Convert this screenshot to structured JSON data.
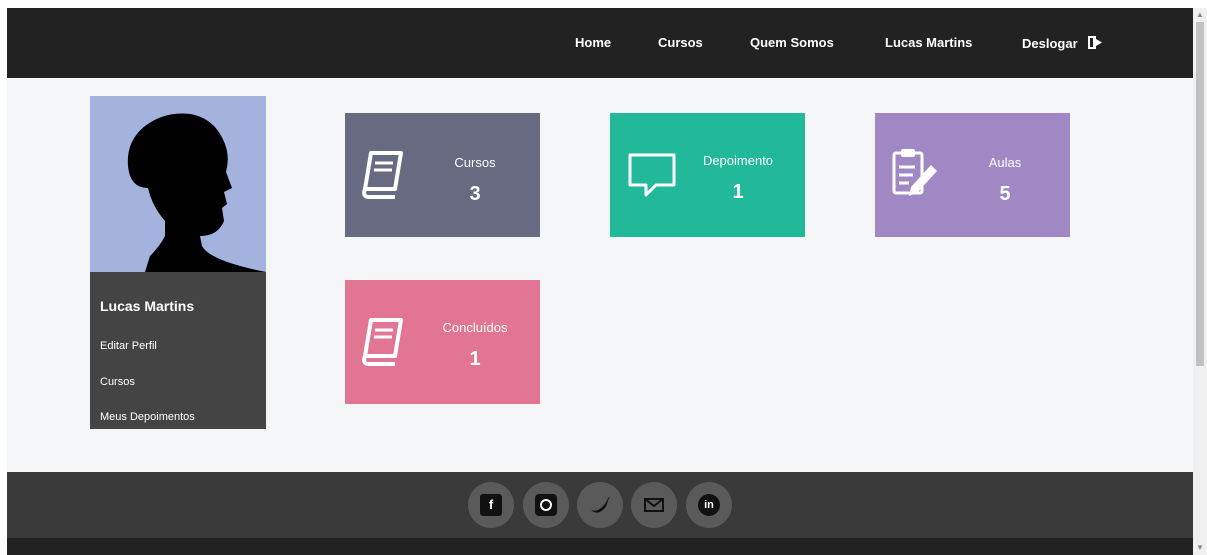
{
  "nav": {
    "items": [
      "Home",
      "Cursos",
      "Quem Somos",
      "Lucas Martins"
    ],
    "logout": "Deslogar"
  },
  "profile": {
    "name": "Lucas Martins",
    "links": [
      "Editar Perfil",
      "Cursos",
      "Meus Depoimentos"
    ]
  },
  "cards": [
    {
      "label": "Cursos",
      "value": "3",
      "color": "#676a80",
      "icon": "book-icon"
    },
    {
      "label": "Depoimento",
      "value": "1",
      "color": "#22b99a",
      "icon": "speech-bubble-icon"
    },
    {
      "label": "Aulas",
      "value": "5",
      "color": "#a088c4",
      "icon": "clipboard-pencil-icon"
    },
    {
      "label": "Concluídos",
      "value": "1",
      "color": "#e27593",
      "icon": "book-icon"
    }
  ],
  "footer": {
    "social": [
      "facebook-icon",
      "instagram-icon",
      "twitter-icon",
      "email-icon",
      "linkedin-icon"
    ]
  },
  "colors": {
    "navbar": "#222222",
    "content_bg": "#f5f6f8",
    "footer": "#3a3a3a"
  }
}
